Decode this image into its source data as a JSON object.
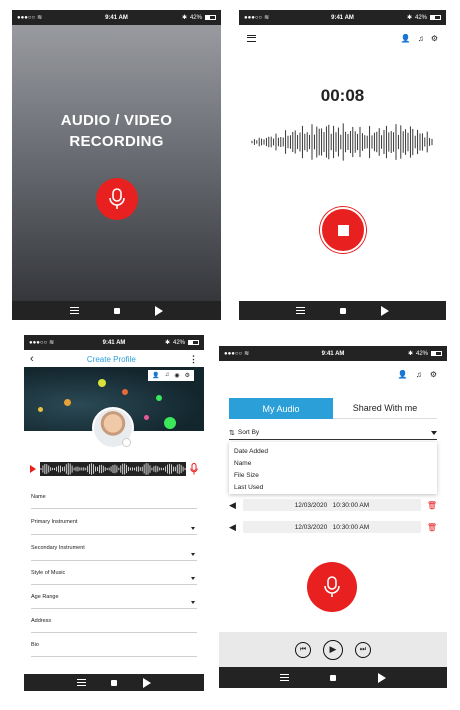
{
  "status": {
    "time": "9:41 AM",
    "battery": "42%"
  },
  "screen1": {
    "title_line1": "AUDIO / VIDEO",
    "title_line2": "RECORDING"
  },
  "screen2": {
    "timer": "00:08"
  },
  "screen3": {
    "header_title": "Create Profile",
    "fields": [
      "Name",
      "Primary Instrument",
      "Secondary  Instrument",
      "Style of Music",
      "Age Range",
      "Address",
      "Bio"
    ]
  },
  "screen4": {
    "tabs": [
      "My Audio",
      "Shared With me"
    ],
    "sort_label": "Sort By",
    "sort_options": [
      "Date Added",
      "Name",
      "File Size",
      "Last Used"
    ],
    "recordings": [
      {
        "date": "12/03/2020",
        "time": "10:30:00 AM"
      },
      {
        "date": "12/03/2020",
        "time": "10:30:00 AM"
      }
    ]
  },
  "colors": {
    "accent_red": "#e8201f",
    "accent_blue": "#2a9fd8",
    "bar_dark": "#232323"
  },
  "icons": [
    "wifi-icon",
    "bluetooth-icon",
    "battery-icon",
    "menu-icon",
    "user-icon",
    "music-note-icon",
    "gear-icon",
    "microphone-icon",
    "stop-icon",
    "play-icon",
    "back-arrow-icon",
    "more-icon",
    "camera-icon",
    "speaker-icon",
    "trash-icon",
    "skip-back-icon",
    "skip-forward-icon",
    "sort-icon"
  ]
}
